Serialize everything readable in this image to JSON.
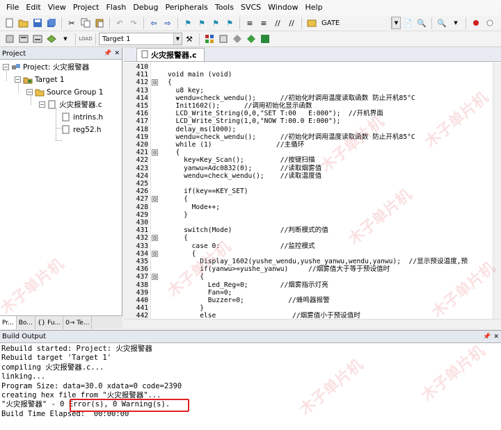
{
  "menu": [
    "File",
    "Edit",
    "View",
    "Project",
    "Flash",
    "Debug",
    "Peripherals",
    "Tools",
    "SVCS",
    "Window",
    "Help"
  ],
  "toolbar": {
    "gate_label": "GATE",
    "target_label": "Target 1"
  },
  "project_panel": {
    "title": "Project",
    "root": "Project: 火灾报警器",
    "target": "Target 1",
    "group": "Source Group 1",
    "file": "火灾报警器.c",
    "includes": [
      "intrins.h",
      "reg52.h"
    ],
    "tabs": [
      "Pr...",
      "Bo...",
      "{} Fu...",
      "0→ Te..."
    ]
  },
  "editor": {
    "tab_label": "火灾报警器.c",
    "lines": [
      {
        "n": "410",
        "fold": "",
        "code": ""
      },
      {
        "n": "411",
        "fold": "",
        "code": "void main (void)"
      },
      {
        "n": "412",
        "fold": "⊟",
        "code": "{"
      },
      {
        "n": "413",
        "fold": "",
        "code": "  u8 key;"
      },
      {
        "n": "414",
        "fold": "",
        "code": "  wendu=check_wendu();      //初始化时调用温度读取函数 防止开机85°C"
      },
      {
        "n": "415",
        "fold": "",
        "code": "  Init1602();      //调用初始化显示函数"
      },
      {
        "n": "416",
        "fold": "",
        "code": "  LCD_Write_String(0,0,\"SET T:00   E:000\");  //开机界面"
      },
      {
        "n": "417",
        "fold": "",
        "code": "  LCD_Write_String(1,0,\"NOW T:00.0 E:000\");"
      },
      {
        "n": "418",
        "fold": "",
        "code": "  delay_ms(1000);"
      },
      {
        "n": "419",
        "fold": "",
        "code": "  wendu=check_wendu();      //初始化时调用温度读取函数 防止开机85°C"
      },
      {
        "n": "420",
        "fold": "",
        "code": "  while (1)                //主循环"
      },
      {
        "n": "421",
        "fold": "⊟",
        "code": "  {"
      },
      {
        "n": "422",
        "fold": "",
        "code": "    key=Key_Scan();         //按键扫描"
      },
      {
        "n": "423",
        "fold": "",
        "code": "    yanwu=Adc0832(0);       //读取烟雾值"
      },
      {
        "n": "424",
        "fold": "",
        "code": "    wendu=check_wendu();    //读取温度值"
      },
      {
        "n": "425",
        "fold": "",
        "code": ""
      },
      {
        "n": "426",
        "fold": "",
        "code": "    if(key==KEY_SET)"
      },
      {
        "n": "427",
        "fold": "⊟",
        "code": "    {"
      },
      {
        "n": "428",
        "fold": "",
        "code": "      Mode++;"
      },
      {
        "n": "429",
        "fold": "",
        "code": "    }"
      },
      {
        "n": "430",
        "fold": "",
        "code": ""
      },
      {
        "n": "431",
        "fold": "",
        "code": "    switch(Mode)            //判断模式的值"
      },
      {
        "n": "432",
        "fold": "⊟",
        "code": "    {"
      },
      {
        "n": "433",
        "fold": "",
        "code": "      case 0:               //监控模式"
      },
      {
        "n": "434",
        "fold": "⊟",
        "code": "      {"
      },
      {
        "n": "435",
        "fold": "",
        "code": "        Display_1602(yushe_wendu,yushe_yanwu,wendu,yanwu);  //显示预设温度,预"
      },
      {
        "n": "436",
        "fold": "",
        "code": "        if(yanwu>=yushe_yanwu)     //烟雾值大于等于预设值时"
      },
      {
        "n": "437",
        "fold": "⊟",
        "code": "        {"
      },
      {
        "n": "438",
        "fold": "",
        "code": "          Led_Reg=0;        //烟雾指示灯亮"
      },
      {
        "n": "439",
        "fold": "",
        "code": "          Fan=0;"
      },
      {
        "n": "440",
        "fold": "",
        "code": "          Buzzer=0;           //蜂鸣器报警"
      },
      {
        "n": "441",
        "fold": "",
        "code": "        }"
      },
      {
        "n": "442",
        "fold": "",
        "code": "        else                   //烟雾值小于预设值时"
      }
    ]
  },
  "build_output": {
    "title": "Build Output",
    "lines": [
      "Rebuild started: Project: 火灾报警器",
      "Rebuild target 'Target 1'",
      "compiling 火灾报警器.c...",
      "linking...",
      "Program Size: data=30.0 xdata=0 code=2390",
      "creating hex file from \"火灾报警器\"...",
      "\"火灾报警器\" - 0 Error(s), 0 Warning(s).",
      "Build Time Elapsed:  00:00:00"
    ]
  },
  "watermark": "木子单片机",
  "colors": {
    "error_highlight": "#e02020",
    "panel_header": "#e4e8ef"
  }
}
